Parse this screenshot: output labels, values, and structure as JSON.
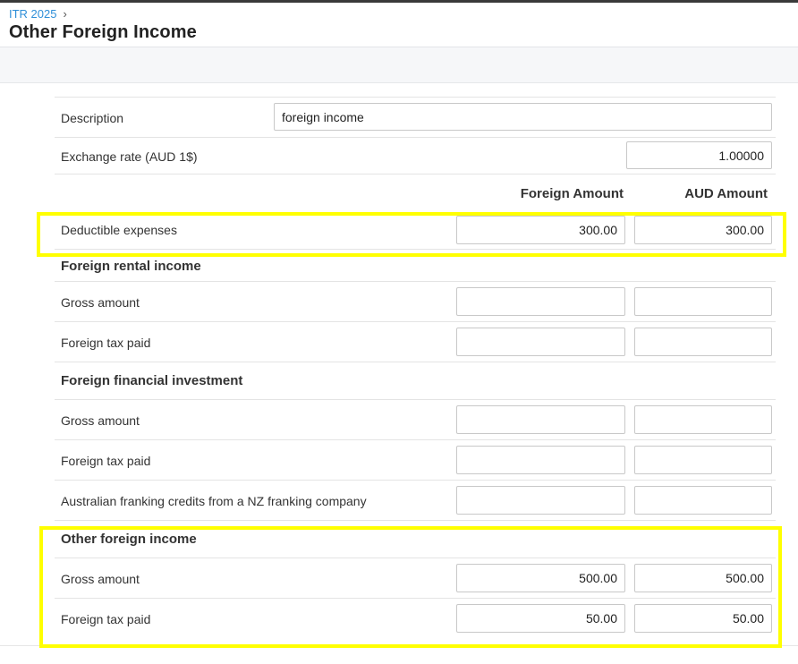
{
  "breadcrumb": {
    "root": "ITR 2025",
    "separator": "›"
  },
  "page": {
    "title": "Other Foreign Income"
  },
  "form": {
    "description_label": "Description",
    "description_value": "foreign income",
    "exchange_rate_label": "Exchange rate (AUD 1$)",
    "exchange_rate_value": "1.00000",
    "col_foreign": "Foreign Amount",
    "col_aud": "AUD Amount",
    "deductible": {
      "label": "Deductible expenses",
      "foreign": "300.00",
      "aud": "300.00"
    },
    "rental": {
      "heading": "Foreign rental income",
      "gross_label": "Gross amount",
      "gross_foreign": "",
      "gross_aud": "",
      "tax_label": "Foreign tax paid",
      "tax_foreign": "",
      "tax_aud": ""
    },
    "financial": {
      "heading": "Foreign financial investment",
      "gross_label": "Gross amount",
      "gross_foreign": "",
      "gross_aud": "",
      "tax_label": "Foreign tax paid",
      "tax_foreign": "",
      "tax_aud": "",
      "franking_label": "Australian franking credits from a NZ franking company",
      "franking_foreign": "",
      "franking_aud": ""
    },
    "other": {
      "heading": "Other foreign income",
      "gross_label": "Gross amount",
      "gross_foreign": "500.00",
      "gross_aud": "500.00",
      "tax_label": "Foreign tax paid",
      "tax_foreign": "50.00",
      "tax_aud": "50.00"
    }
  },
  "colors": {
    "highlight": "#ffff00",
    "link": "#2f8fd8"
  }
}
